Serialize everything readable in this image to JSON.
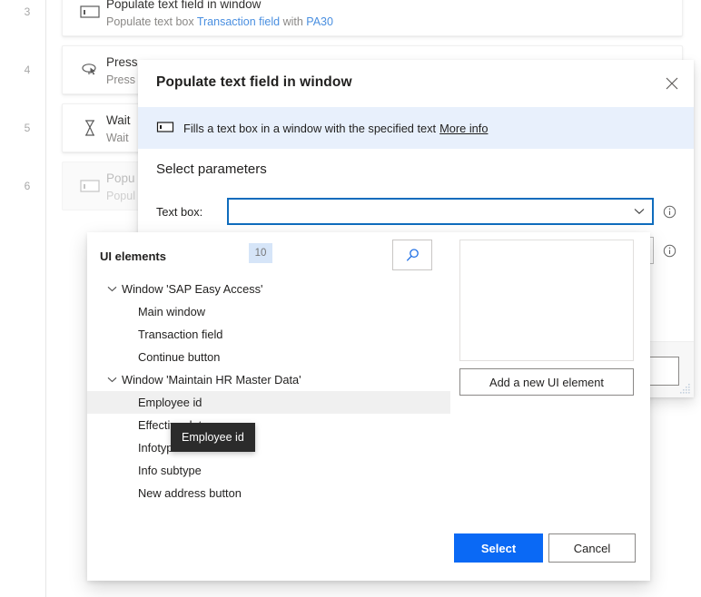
{
  "flow": {
    "rows": [
      {
        "num": "3",
        "icon": "textbox-icon",
        "title": "Populate text field in window",
        "desc_pre": "Populate text box ",
        "desc_link1": "Transaction field",
        "desc_mid": " with ",
        "desc_link2": "PA30",
        "dimmed": false
      },
      {
        "num": "4",
        "icon": "mouse-click-icon",
        "title": "Press",
        "desc_pre": "Press",
        "desc_link1": "",
        "desc_mid": "",
        "desc_link2": "",
        "dimmed": false
      },
      {
        "num": "5",
        "icon": "hourglass-icon",
        "title": "Wait",
        "desc_pre": "Wait",
        "desc_link1": "",
        "desc_mid": "",
        "desc_link2": "",
        "dimmed": false
      },
      {
        "num": "6",
        "icon": "textbox-icon",
        "title": "Popu",
        "desc_pre": "Popul",
        "desc_link1": "",
        "desc_mid": "",
        "desc_link2": "",
        "dimmed": true
      }
    ]
  },
  "dialog": {
    "title": "Populate text field in window",
    "close_icon": "close-icon",
    "banner": {
      "icon": "textbox-icon",
      "text": "Fills a text box in a window with the specified text",
      "link": "More info"
    },
    "section_title": "Select parameters",
    "params": [
      {
        "label": "Text box:",
        "value": "",
        "placeholder": "",
        "chevron_icon": "chevron-down-icon",
        "info_icon": "info-icon",
        "focused": true
      },
      {
        "label": "",
        "value": "",
        "placeholder": "",
        "chevron_icon": "chevron-down-icon",
        "info_icon": "info-icon",
        "focused": false
      }
    ],
    "footer": {
      "primary_label": "",
      "secondary_label": ""
    },
    "resize_grip": "resize-grip-icon"
  },
  "picker": {
    "header_label": "UI elements",
    "badge_count": "10",
    "search_icon": "search-icon",
    "tree": [
      {
        "level": 0,
        "label": "Window 'SAP Easy Access'",
        "expandable": true,
        "twisty": "chevron-down-icon",
        "selected": false
      },
      {
        "level": 1,
        "label": "Main window",
        "expandable": false,
        "twisty": "",
        "selected": false
      },
      {
        "level": 1,
        "label": "Transaction field",
        "expandable": false,
        "twisty": "",
        "selected": false
      },
      {
        "level": 1,
        "label": "Continue button",
        "expandable": false,
        "twisty": "",
        "selected": false
      },
      {
        "level": 0,
        "label": "Window 'Maintain HR Master Data'",
        "expandable": true,
        "twisty": "chevron-down-icon",
        "selected": false
      },
      {
        "level": 1,
        "label": "Employee id",
        "expandable": false,
        "twisty": "",
        "selected": true
      },
      {
        "level": 1,
        "label": "Effective date",
        "expandable": false,
        "twisty": "",
        "selected": false
      },
      {
        "level": 1,
        "label": "Infotype",
        "expandable": false,
        "twisty": "",
        "selected": false
      },
      {
        "level": 1,
        "label": "Info subtype",
        "expandable": false,
        "twisty": "",
        "selected": false
      },
      {
        "level": 1,
        "label": "New address button",
        "expandable": false,
        "twisty": "",
        "selected": false
      }
    ],
    "add_element_label": "Add a new UI element",
    "select_label": "Select",
    "cancel_label": "Cancel"
  },
  "tooltip": {
    "text": "Employee id"
  },
  "colors": {
    "accent_blue": "#0a69f5",
    "banner_blue": "#e8f0fc",
    "badge_blue": "#d6e5f8",
    "link_blue": "#4a8fe0",
    "focus_border": "#0f6cbd",
    "tooltip_bg": "#2b2b2b",
    "selected_row": "#f0f0f0"
  }
}
